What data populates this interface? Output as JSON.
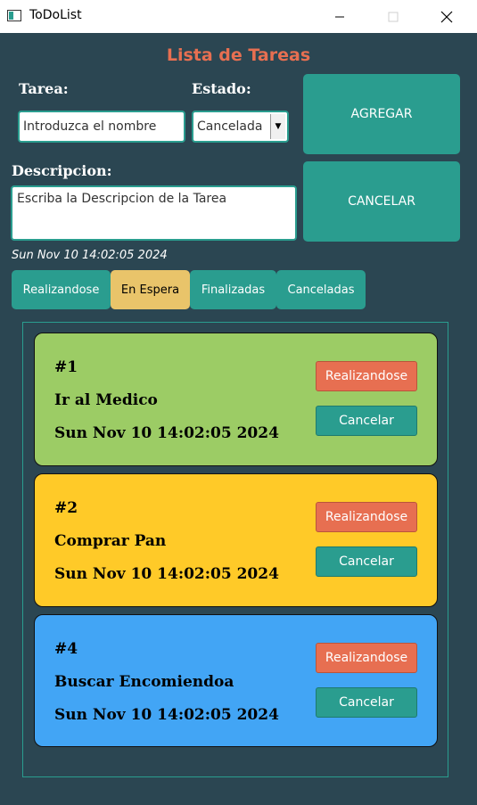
{
  "window": {
    "title": "ToDoList"
  },
  "header": {
    "title": "Lista de Tareas"
  },
  "form": {
    "task_label": "Tarea:",
    "task_placeholder": "Introduzca el nombre",
    "status_label": "Estado:",
    "status_selected": "Cancelada",
    "description_label": "Descripcion:",
    "description_placeholder": "Escriba la Descripcion de la Tarea",
    "add_label": "AGREGAR",
    "cancel_label": "CANCELAR",
    "timestamp": "Sun Nov 10 14:02:05 2024"
  },
  "tabs": [
    {
      "label": "Realizandose",
      "active": false
    },
    {
      "label": "En Espera",
      "active": true
    },
    {
      "label": "Finalizadas",
      "active": false
    },
    {
      "label": "Canceladas",
      "active": false
    }
  ],
  "tasks": [
    {
      "number": "#1",
      "name": "Ir al Medico",
      "date": "Sun Nov 10 14:02:05 2024",
      "color": "#9ccc65",
      "action_label": "Realizandose",
      "cancel_label": "Cancelar"
    },
    {
      "number": "#2",
      "name": "Comprar Pan",
      "date": "Sun Nov 10 14:02:05 2024",
      "color": "#ffca28",
      "action_label": "Realizandose",
      "cancel_label": "Cancelar"
    },
    {
      "number": "#4",
      "name": "Buscar Encomiendoa",
      "date": "Sun Nov 10 14:02:05 2024",
      "color": "#42a5f5",
      "action_label": "Realizandose",
      "cancel_label": "Cancelar"
    }
  ],
  "colors": {
    "accent": "#2a9d8f",
    "heading": "#e76f51",
    "active_tab": "#e9c46a",
    "background": "#2b4652"
  }
}
